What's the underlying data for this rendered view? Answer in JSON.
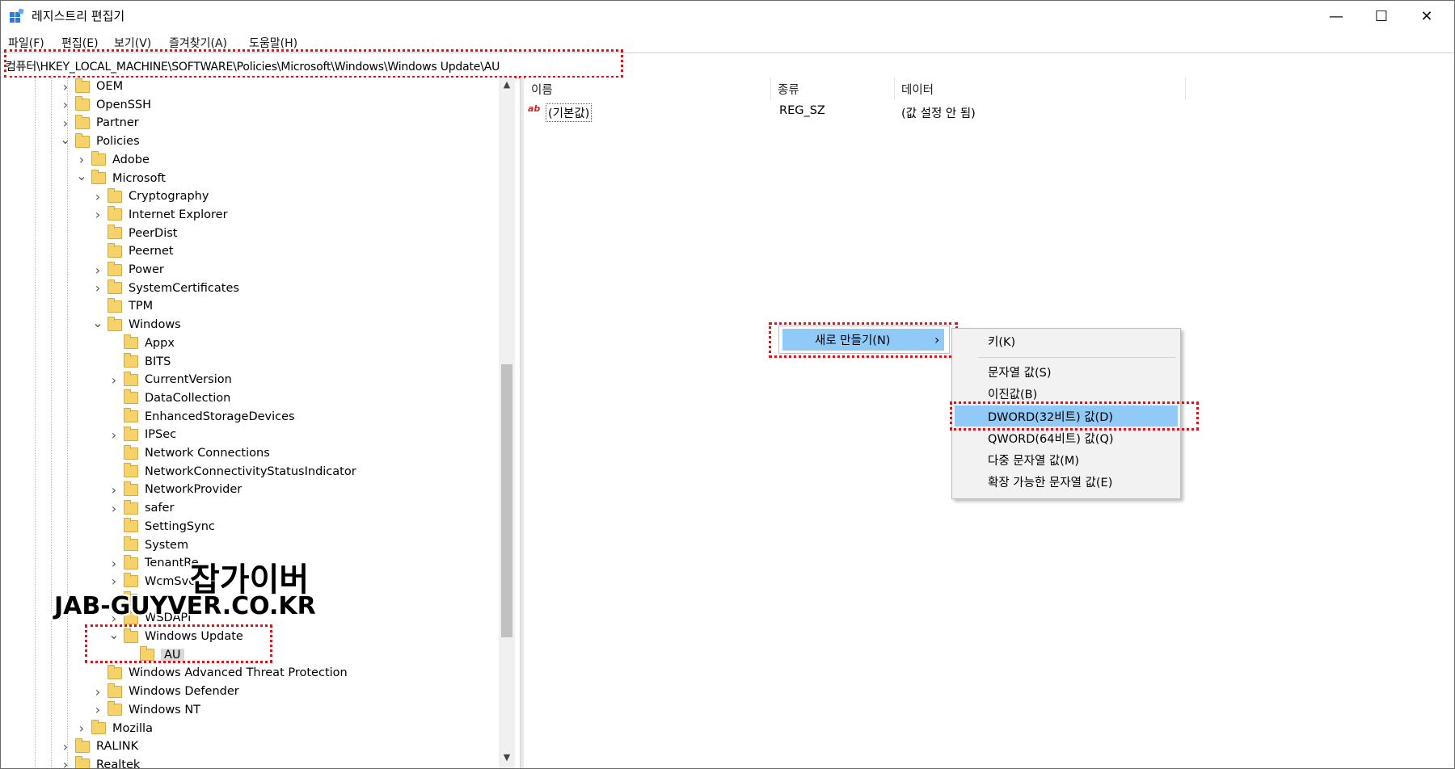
{
  "window": {
    "title": "레지스트리 편집기",
    "minimize": "—",
    "maximize": "☐",
    "close": "✕"
  },
  "menu": [
    "파일(F)",
    "편집(E)",
    "보기(V)",
    "즐겨찾기(A)",
    "도움말(H)"
  ],
  "address": "컴퓨터\\HKEY_LOCAL_MACHINE\\SOFTWARE\\Policies\\Microsoft\\Windows\\Windows Update\\AU",
  "tree": [
    {
      "label": "OEM",
      "level": 0,
      "chevron": ">"
    },
    {
      "label": "OpenSSH",
      "level": 0,
      "chevron": ">"
    },
    {
      "label": "Partner",
      "level": 0,
      "chevron": ">"
    },
    {
      "label": "Policies",
      "level": 0,
      "chevron": "v"
    },
    {
      "label": "Adobe",
      "level": 1,
      "chevron": ">"
    },
    {
      "label": "Microsoft",
      "level": 1,
      "chevron": "v"
    },
    {
      "label": "Cryptography",
      "level": 2,
      "chevron": ">"
    },
    {
      "label": "Internet Explorer",
      "level": 2,
      "chevron": ">"
    },
    {
      "label": "PeerDist",
      "level": 2,
      "chevron": ""
    },
    {
      "label": "Peernet",
      "level": 2,
      "chevron": ""
    },
    {
      "label": "Power",
      "level": 2,
      "chevron": ">"
    },
    {
      "label": "SystemCertificates",
      "level": 2,
      "chevron": ">"
    },
    {
      "label": "TPM",
      "level": 2,
      "chevron": ""
    },
    {
      "label": "Windows",
      "level": 2,
      "chevron": "v"
    },
    {
      "label": "Appx",
      "level": 3,
      "chevron": ""
    },
    {
      "label": "BITS",
      "level": 3,
      "chevron": ""
    },
    {
      "label": "CurrentVersion",
      "level": 3,
      "chevron": ">"
    },
    {
      "label": "DataCollection",
      "level": 3,
      "chevron": ""
    },
    {
      "label": "EnhancedStorageDevices",
      "level": 3,
      "chevron": ""
    },
    {
      "label": "IPSec",
      "level": 3,
      "chevron": ">"
    },
    {
      "label": "Network Connections",
      "level": 3,
      "chevron": ""
    },
    {
      "label": "NetworkConnectivityStatusIndicator",
      "level": 3,
      "chevron": ""
    },
    {
      "label": "NetworkProvider",
      "level": 3,
      "chevron": ">"
    },
    {
      "label": "safer",
      "level": 3,
      "chevron": ">"
    },
    {
      "label": "SettingSync",
      "level": 3,
      "chevron": ""
    },
    {
      "label": "System",
      "level": 3,
      "chevron": ""
    },
    {
      "label": "TenantRe",
      "level": 3,
      "chevron": ">"
    },
    {
      "label": "WcmSvc",
      "level": 3,
      "chevron": ">"
    },
    {
      "label": "",
      "level": 3,
      "chevron": ""
    },
    {
      "label": "WSDAPI",
      "level": 3,
      "chevron": ">"
    },
    {
      "label": "Windows Update",
      "level": 3,
      "chevron": "v"
    },
    {
      "label": "AU",
      "level": 4,
      "chevron": "",
      "selected": true
    },
    {
      "label": "Windows Advanced Threat Protection",
      "level": 2,
      "chevron": ""
    },
    {
      "label": "Windows Defender",
      "level": 2,
      "chevron": ">"
    },
    {
      "label": "Windows NT",
      "level": 2,
      "chevron": ">"
    },
    {
      "label": "Mozilla",
      "level": 1,
      "chevron": ">"
    },
    {
      "label": "RALINK",
      "level": 0,
      "chevron": ">"
    },
    {
      "label": "Realtek",
      "level": 0,
      "chevron": ">"
    }
  ],
  "columns": {
    "name": "이름",
    "type": "종류",
    "data": "데이터"
  },
  "values": [
    {
      "name": "(기본값)",
      "type": "REG_SZ",
      "data": "(값 설정 안 됨)",
      "icon": "ab"
    }
  ],
  "context_menu": {
    "new_label": "새로 만들기(N)",
    "arrow": "›",
    "submenu": [
      "키(K)",
      "문자열 값(S)",
      "이진값(B)",
      "DWORD(32비트) 값(D)",
      "QWORD(64비트) 값(Q)",
      "다중 문자열 값(M)",
      "확장 가능한 문자열 값(E)"
    ],
    "highlighted": "DWORD(32비트) 값(D)"
  },
  "watermark": {
    "line1": "잡가이버",
    "line2": "JAB-GUYVER.CO.KR"
  },
  "colors": {
    "highlight": "#91c9f7",
    "annotation": "#d6161d",
    "folder": "#f6d36a"
  }
}
